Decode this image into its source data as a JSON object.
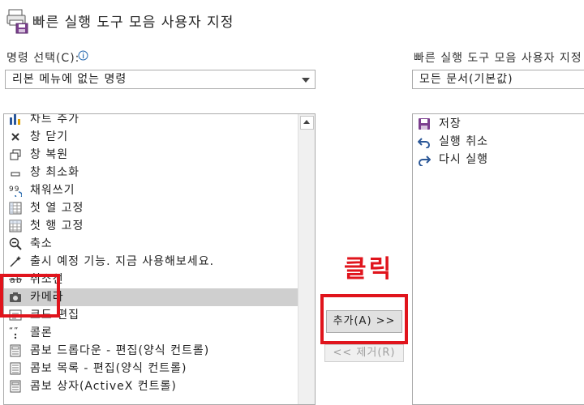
{
  "window": {
    "title": "빠른 실행 도구 모음 사용자 지정",
    "icon": "printer-save-icon"
  },
  "left": {
    "label": "명령 선택(C):",
    "info_icon": "info-icon",
    "combo_value": "리본 메뉴에 없는 명령",
    "items": [
      {
        "label": "차트 추가",
        "icon": "chart-icon"
      },
      {
        "label": "창 닫기",
        "icon": "close-icon"
      },
      {
        "label": "창 복원",
        "icon": "restore-window-icon"
      },
      {
        "label": "창 최소화",
        "icon": "minimize-icon"
      },
      {
        "label": "채워쓰기",
        "icon": "overtype-icon"
      },
      {
        "label": "첫 열 고정",
        "icon": "freeze-column-icon"
      },
      {
        "label": "첫 행 고정",
        "icon": "freeze-row-icon"
      },
      {
        "label": "축소",
        "icon": "zoom-out-icon"
      },
      {
        "label": "출시 예정 기능. 지금 사용해보세요.",
        "icon": "wand-icon"
      },
      {
        "label": "취소선",
        "icon": "strikethrough-icon"
      },
      {
        "label": "카메라",
        "icon": "camera-icon"
      },
      {
        "label": "코드 편집",
        "icon": "code-edit-icon"
      },
      {
        "label": "콜론",
        "icon": "colon-icon"
      },
      {
        "label": "콤보 드롭다운 - 편집(양식 컨트롤)",
        "icon": "combo-dropdown-icon"
      },
      {
        "label": "콤보 목록 - 편집(양식 컨트롤)",
        "icon": "combo-list-icon"
      },
      {
        "label": "콤보 상자(ActiveX 컨트롤)",
        "icon": "combo-box-icon"
      }
    ],
    "selected_index": 10
  },
  "buttons": {
    "add": "추가(A) >>",
    "remove": "<< 제거(R)"
  },
  "annotation": {
    "text": "클릭",
    "color": "#e0141c"
  },
  "right": {
    "label": "빠른 실행 도구 모음 사용자 지정",
    "combo_value": "모든 문서(기본값)",
    "items": [
      {
        "label": "저장",
        "icon": "save-icon"
      },
      {
        "label": "실행 취소",
        "icon": "undo-icon"
      },
      {
        "label": "다시 실행",
        "icon": "redo-icon"
      }
    ]
  }
}
